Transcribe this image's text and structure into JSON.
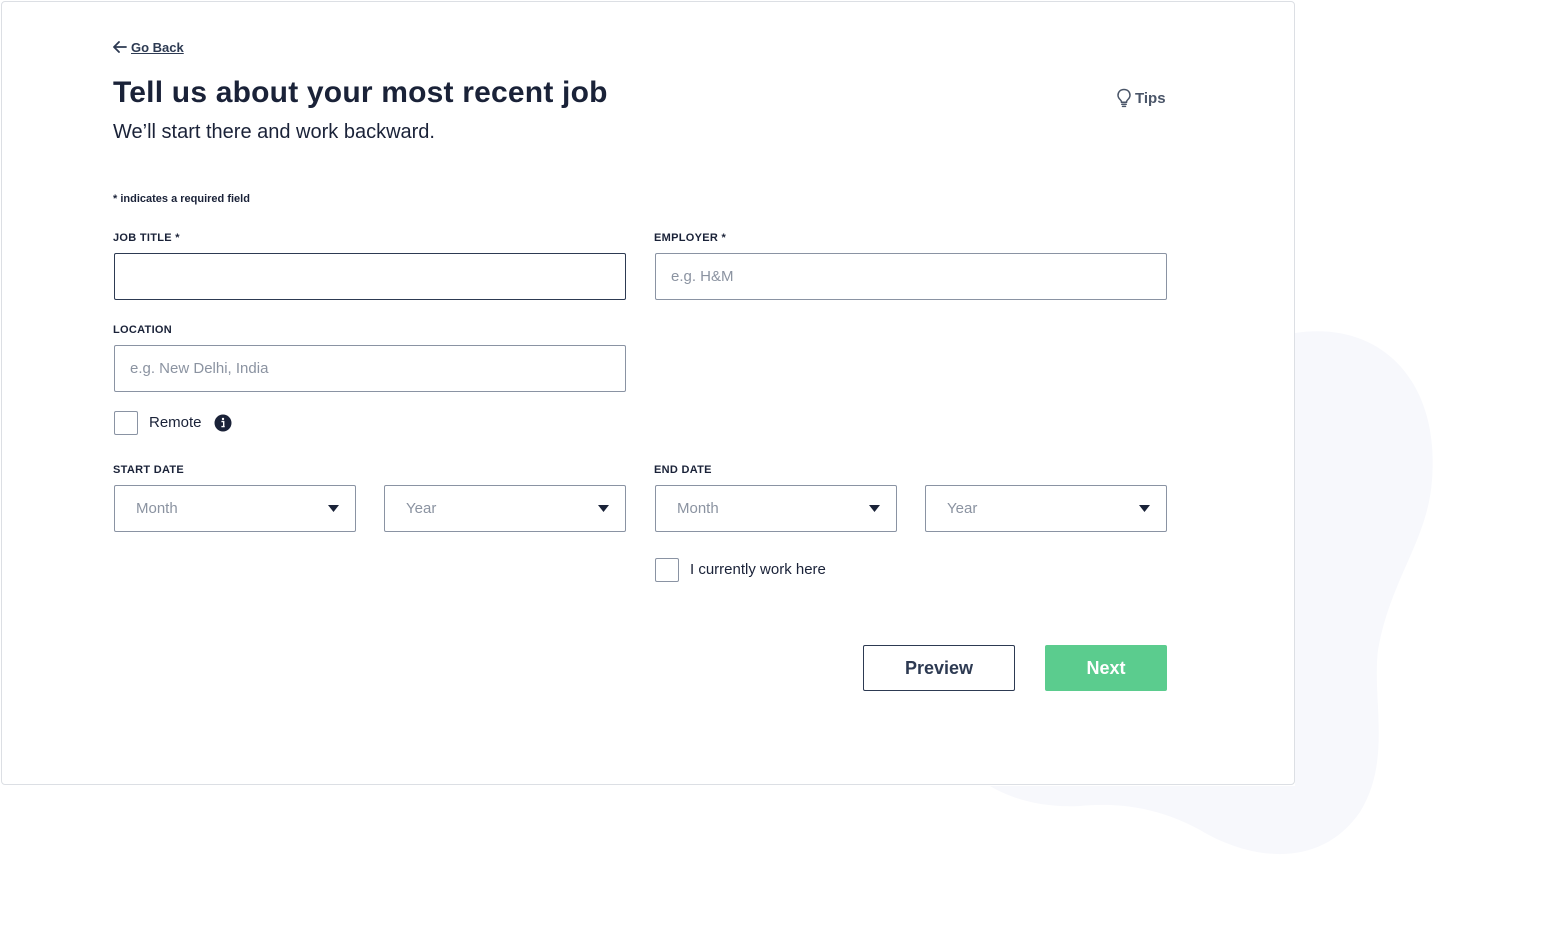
{
  "nav": {
    "go_back_label": "Go Back"
  },
  "header": {
    "title": "Tell us about your most recent job",
    "subtitle": "We’ll start there and work backward.",
    "tips_label": "Tips"
  },
  "form": {
    "required_note": "* indicates a required field",
    "job_title": {
      "label": "JOB TITLE *",
      "value": "",
      "placeholder": ""
    },
    "employer": {
      "label": "EMPLOYER *",
      "value": "",
      "placeholder": "e.g. H&M"
    },
    "location": {
      "label": "LOCATION",
      "value": "",
      "placeholder": "e.g. New Delhi, India"
    },
    "remote": {
      "label": "Remote",
      "checked": false
    },
    "start_date": {
      "label": "START DATE",
      "month": "Month",
      "year": "Year"
    },
    "end_date": {
      "label": "END DATE",
      "month": "Month",
      "year": "Year"
    },
    "current_job": {
      "label": "I currently work here",
      "checked": false
    }
  },
  "actions": {
    "preview_label": "Preview",
    "next_label": "Next"
  },
  "colors": {
    "accent_green": "#5bcc8e",
    "text_dark": "#1a2238",
    "border": "#8a93a3",
    "blob": "#f7f8fc"
  }
}
